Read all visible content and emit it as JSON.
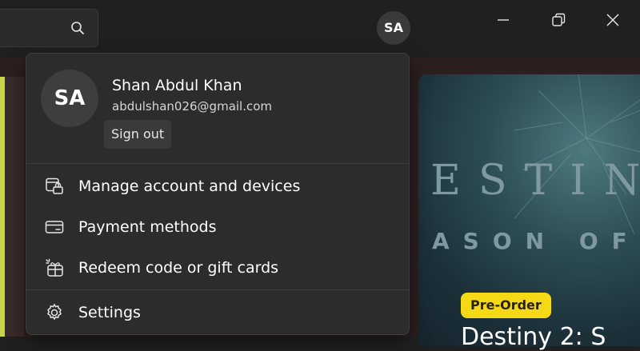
{
  "header": {
    "avatar_initials": "SA"
  },
  "account": {
    "initials": "SA",
    "name": "Shan Abdul Khan",
    "email": "abdulshan026@gmail.com",
    "sign_out_label": "Sign out"
  },
  "menu": {
    "items": [
      {
        "label": "Manage account and devices",
        "icon": "account-devices-icon"
      },
      {
        "label": "Payment methods",
        "icon": "credit-card-icon"
      },
      {
        "label": "Redeem code or gift cards",
        "icon": "gift-card-icon"
      },
      {
        "label": "Settings",
        "icon": "gear-icon"
      }
    ]
  },
  "background": {
    "promo_title": "ESTIN",
    "promo_subtitle": "ASON OF",
    "badge": "Pre-Order",
    "bottom_text": "Destiny 2: S",
    "badge_color": "#F5D816"
  },
  "colors": {
    "flyout_bg": "#2C2C2C",
    "window_bg": "#202020",
    "accent": "#C8D44A"
  }
}
